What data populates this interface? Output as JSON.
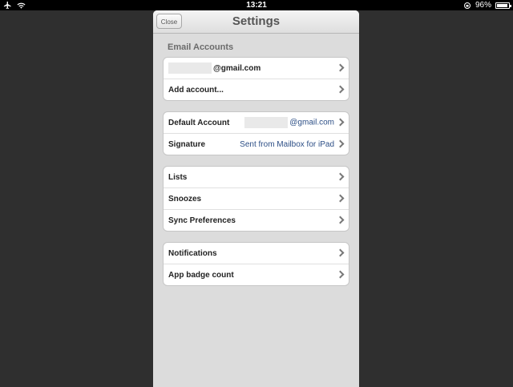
{
  "status_bar": {
    "time": "13:21",
    "battery": "96%",
    "battery_level": 0.96
  },
  "header": {
    "title": "Settings",
    "close_label": "Close"
  },
  "sections": {
    "email_accounts_header": "Email Accounts",
    "account_email_suffix": "@gmail.com",
    "add_account": "Add account...",
    "default_account_label": "Default Account",
    "default_account_value": "@gmail.com",
    "signature_label": "Signature",
    "signature_value": "Sent from Mailbox for iPad",
    "lists": "Lists",
    "snoozes": "Snoozes",
    "sync_preferences": "Sync Preferences",
    "notifications": "Notifications",
    "app_badge_count": "App badge count"
  },
  "colors": {
    "accent_value": "#2d4f86",
    "modal_bg": "#dcdcdc",
    "backdrop": "#2f2f2f"
  }
}
